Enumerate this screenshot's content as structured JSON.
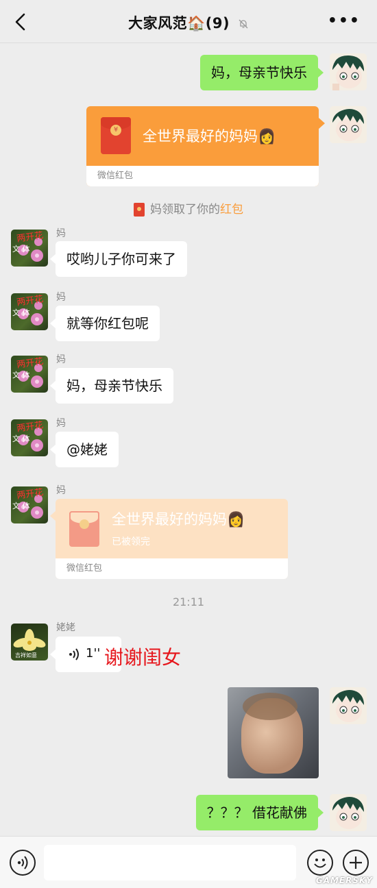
{
  "header": {
    "title": "大家风范🏠(9)"
  },
  "messages": {
    "m1": {
      "text": "妈，母亲节快乐"
    },
    "redpacket1": {
      "title": "全世界最好的妈妈👩",
      "footer": "微信红包"
    },
    "system": {
      "prefix": "妈领取了你的",
      "highlight": "红包"
    },
    "m2": {
      "sender": "妈",
      "text": "哎哟儿子你可来了"
    },
    "m3": {
      "sender": "妈",
      "text": "就等你红包呢"
    },
    "m4": {
      "sender": "妈",
      "text": "妈，母亲节快乐"
    },
    "m5": {
      "sender": "妈",
      "text": "@姥姥"
    },
    "redpacket2": {
      "sender": "妈",
      "title": "全世界最好的妈妈👩",
      "status": "已被领完",
      "footer": "微信红包"
    },
    "time": "21:11",
    "voice": {
      "sender": "姥姥",
      "duration": "1''",
      "caption": "谢谢闺女"
    },
    "m6": {
      "text": "？？？ 借花献佛"
    }
  },
  "avatars": {
    "flower_text": "两开花",
    "flower_sub": "文 体",
    "lily_text": "吉祥如意"
  },
  "colors": {
    "bubble_green": "#95ec69",
    "red_packet": "#fa9d3b",
    "red_packet_opened": "#fde1c3",
    "caption_red": "#e6161c",
    "highlight": "#fa9d3b"
  },
  "watermark": "GAMERSKY"
}
